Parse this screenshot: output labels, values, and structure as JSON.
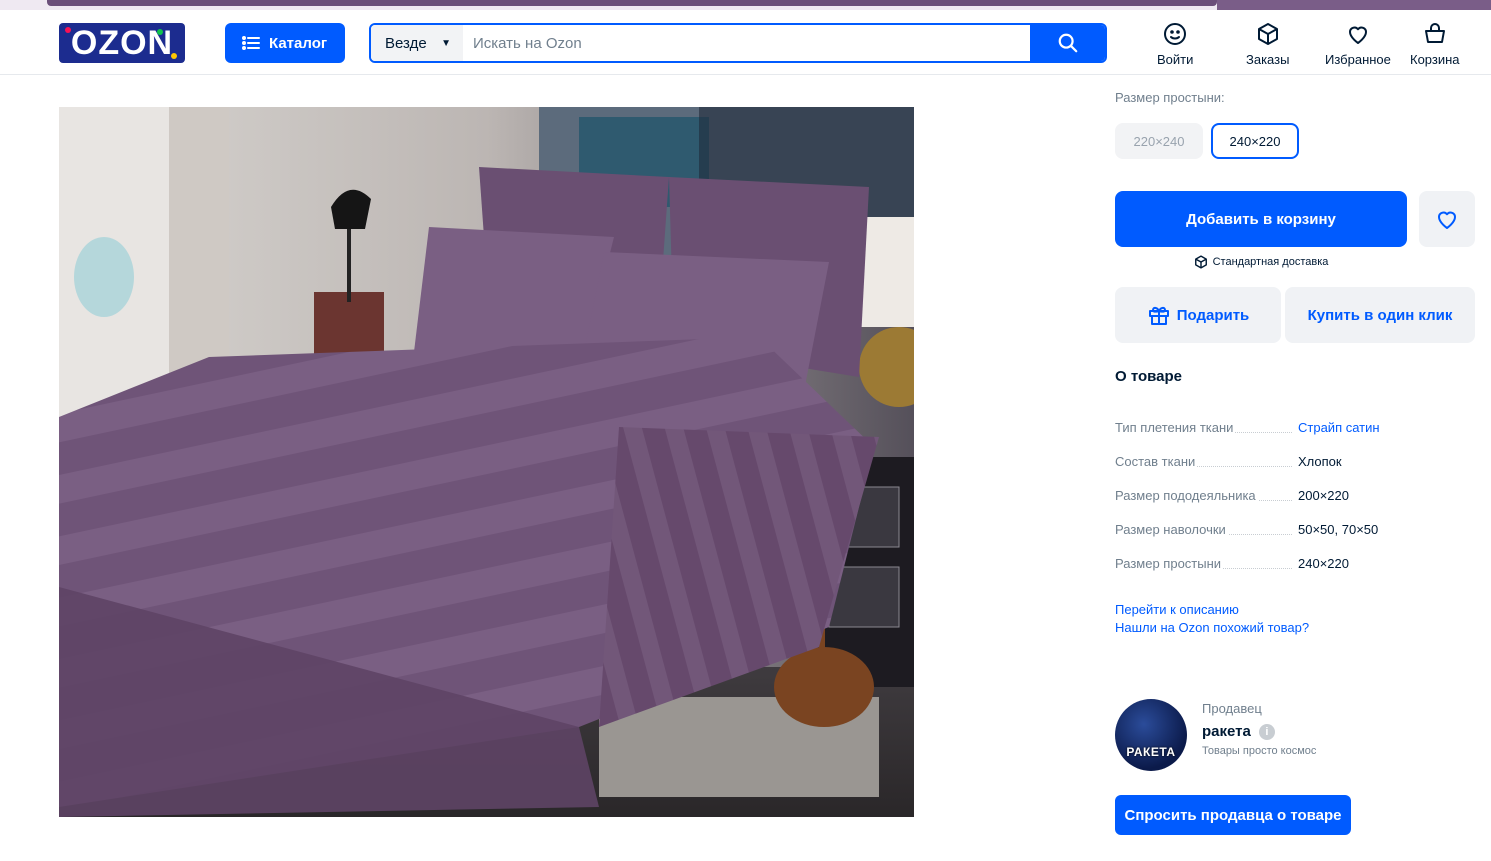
{
  "header": {
    "logo_text": "OZON",
    "catalog_label": "Каталог",
    "search": {
      "scope": "Везде",
      "placeholder": "Искать на Ozon",
      "value": ""
    },
    "nav": [
      {
        "label": "Войти",
        "icon": "smile-icon"
      },
      {
        "label": "Заказы",
        "icon": "box-icon"
      },
      {
        "label": "Избранное",
        "icon": "heart-icon"
      },
      {
        "label": "Корзина",
        "icon": "basket-icon"
      }
    ]
  },
  "product": {
    "image_alt": "Purple striped bedding set",
    "size_label": "Размер простыни:",
    "sizes": [
      {
        "label": "220×240",
        "state": "disabled"
      },
      {
        "label": "240×220",
        "state": "selected"
      }
    ],
    "add_to_cart": "Добавить в корзину",
    "delivery": "Стандартная доставка",
    "gift": "Подарить",
    "one_click": "Купить в один клик",
    "about_title": "О товаре",
    "specs": [
      {
        "key": "Тип плетения ткани",
        "value": "Страйп сатин",
        "link": true
      },
      {
        "key": "Состав ткани",
        "value": "Хлопок",
        "link": false
      },
      {
        "key": "Размер пододеяльника",
        "value": "200×220",
        "link": false
      },
      {
        "key": "Размер наволочки",
        "value": "50×50, 70×50",
        "link": false
      },
      {
        "key": "Размер простыни",
        "value": "240×220",
        "link": false
      }
    ],
    "go_to_description": "Перейти к описанию",
    "found_cheaper": "Нашли на Ozon похожий товар?"
  },
  "seller": {
    "label": "Продавец",
    "name": "ракета",
    "tagline": "Товары просто космос",
    "avatar_text": "РАКЕТА",
    "ask_button": "Спросить продавца о товаре"
  },
  "colors": {
    "brand": "#005bff",
    "logo_bg": "#1c2c8f",
    "text": "#001a34",
    "muted": "#707f8d"
  }
}
